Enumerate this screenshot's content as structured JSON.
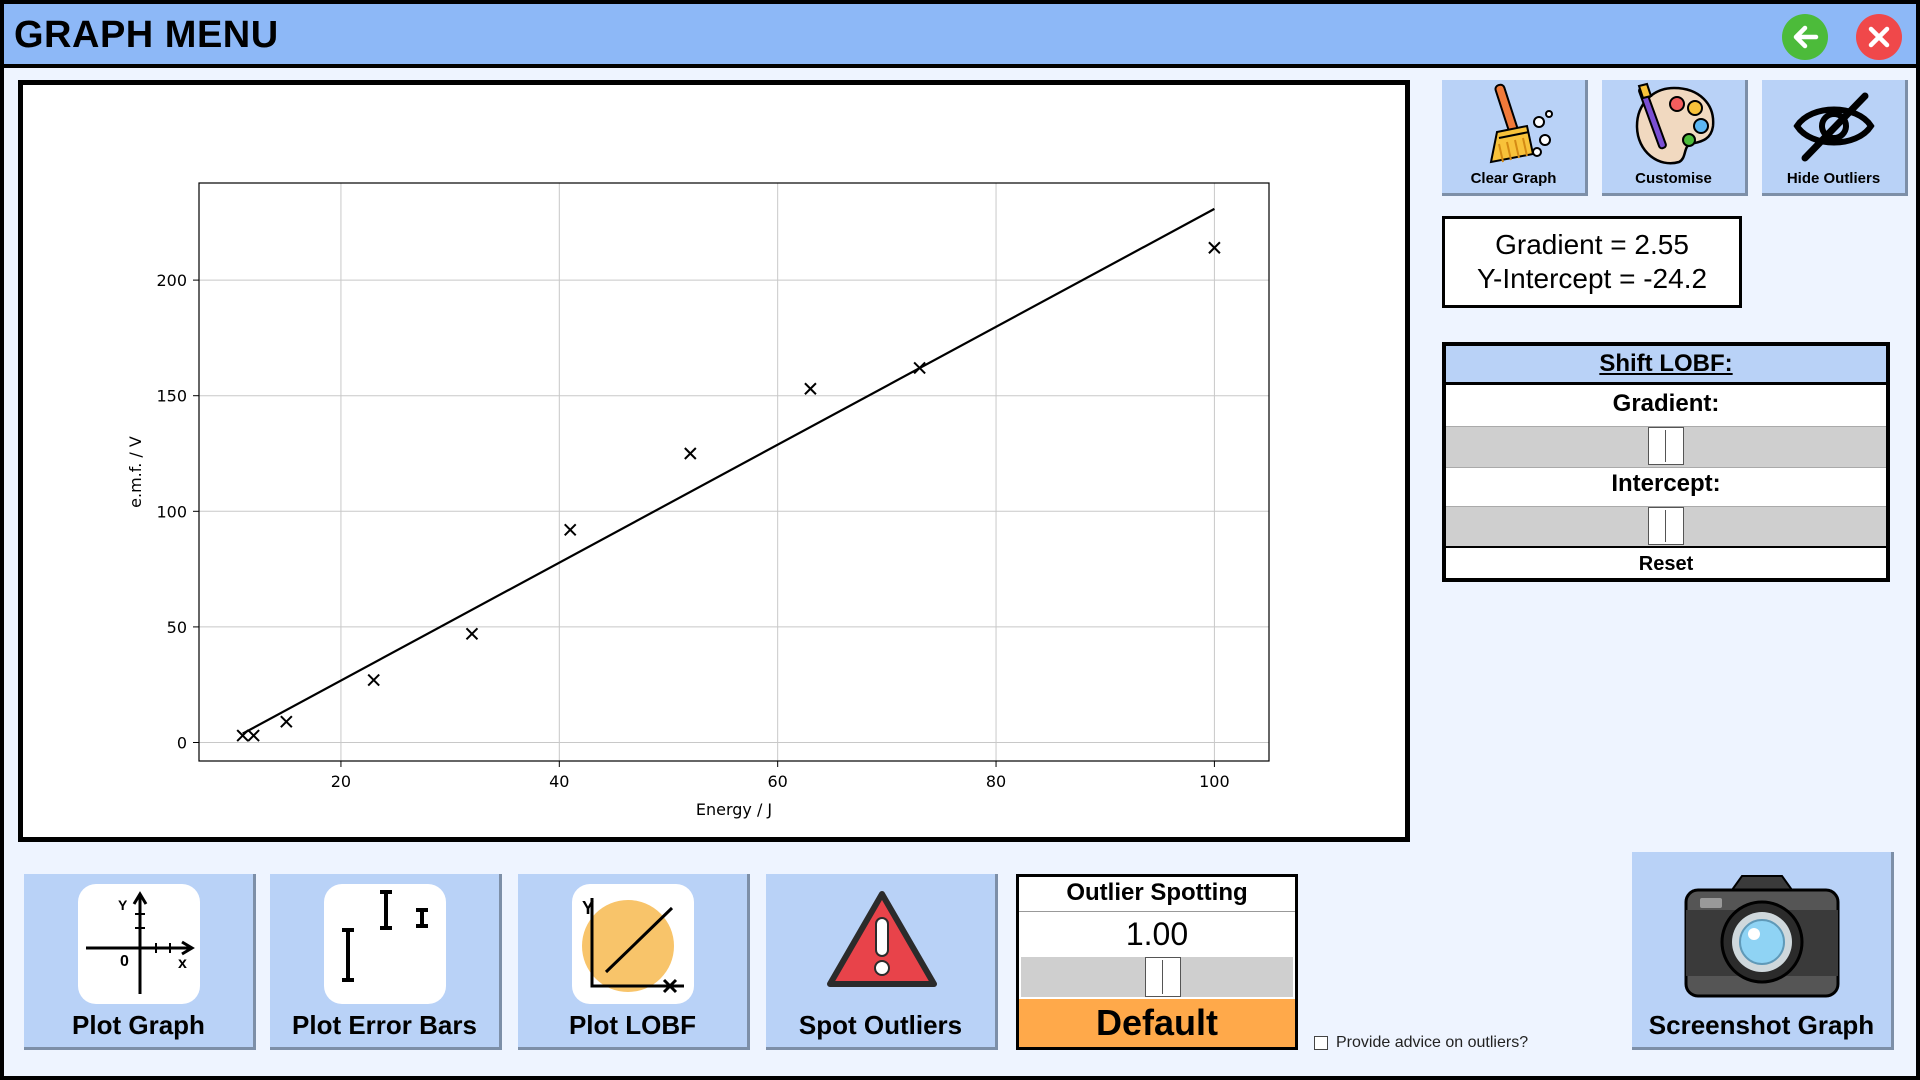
{
  "window": {
    "title": "GRAPH MENU",
    "back_icon": "arrow-left-icon",
    "close_icon": "close-icon",
    "colors": {
      "titlebar": "#8db8f7",
      "back": "#4cbb3a",
      "close": "#f0484a",
      "button": "#b9d2f7",
      "default_button": "#ffa94a"
    }
  },
  "toolbar": {
    "clear_graph": {
      "label": "Clear Graph",
      "icon": "broom-icon"
    },
    "customise": {
      "label": "Customise",
      "icon": "palette-icon"
    },
    "hide_outliers": {
      "label": "Hide Outliers",
      "icon": "eye-slash-icon"
    }
  },
  "lobf_info": {
    "gradient_text": "Gradient = 2.55",
    "intercept_text": "Y-Intercept = -24.2"
  },
  "shift_lobf": {
    "title": "Shift LOBF:",
    "gradient_label": "Gradient:",
    "gradient_slider_value": 0.5,
    "intercept_label": "Intercept:",
    "intercept_slider_value": 0.5,
    "reset_label": "Reset"
  },
  "bottom_buttons": {
    "plot_graph": {
      "label": "Plot Graph",
      "icon": "axes-icon"
    },
    "plot_error_bars": {
      "label": "Plot Error Bars",
      "icon": "error-bars-icon"
    },
    "plot_lobf": {
      "label": "Plot LOBF",
      "icon": "line-of-best-fit-icon"
    },
    "spot_outliers": {
      "label": "Spot Outliers",
      "icon": "warning-icon"
    }
  },
  "outlier_spotting": {
    "title": "Outlier Spotting",
    "value": "1.00",
    "slider_value": 0.5,
    "default_label": "Default"
  },
  "advice": {
    "label": "Provide advice on outliers?",
    "checked": false
  },
  "screenshot": {
    "label": "Screenshot Graph",
    "icon": "camera-icon"
  },
  "chart_data": {
    "type": "scatter",
    "title": "",
    "xlabel": "Energy / J",
    "ylabel": "e.m.f. / V",
    "xlim": [
      7,
      105
    ],
    "ylim": [
      -8,
      242
    ],
    "xticks": [
      20,
      40,
      60,
      80,
      100
    ],
    "yticks": [
      0,
      50,
      100,
      150,
      200
    ],
    "grid": true,
    "marker": "x",
    "points": [
      {
        "x": 11,
        "y": 3
      },
      {
        "x": 12,
        "y": 3
      },
      {
        "x": 15,
        "y": 9
      },
      {
        "x": 23,
        "y": 27
      },
      {
        "x": 32,
        "y": 47
      },
      {
        "x": 41,
        "y": 92
      },
      {
        "x": 52,
        "y": 125
      },
      {
        "x": 63,
        "y": 153
      },
      {
        "x": 73,
        "y": 162
      },
      {
        "x": 100,
        "y": 214
      }
    ],
    "line_of_best_fit": {
      "gradient": 2.55,
      "intercept": -24.2,
      "x_range": [
        11,
        100
      ]
    }
  }
}
